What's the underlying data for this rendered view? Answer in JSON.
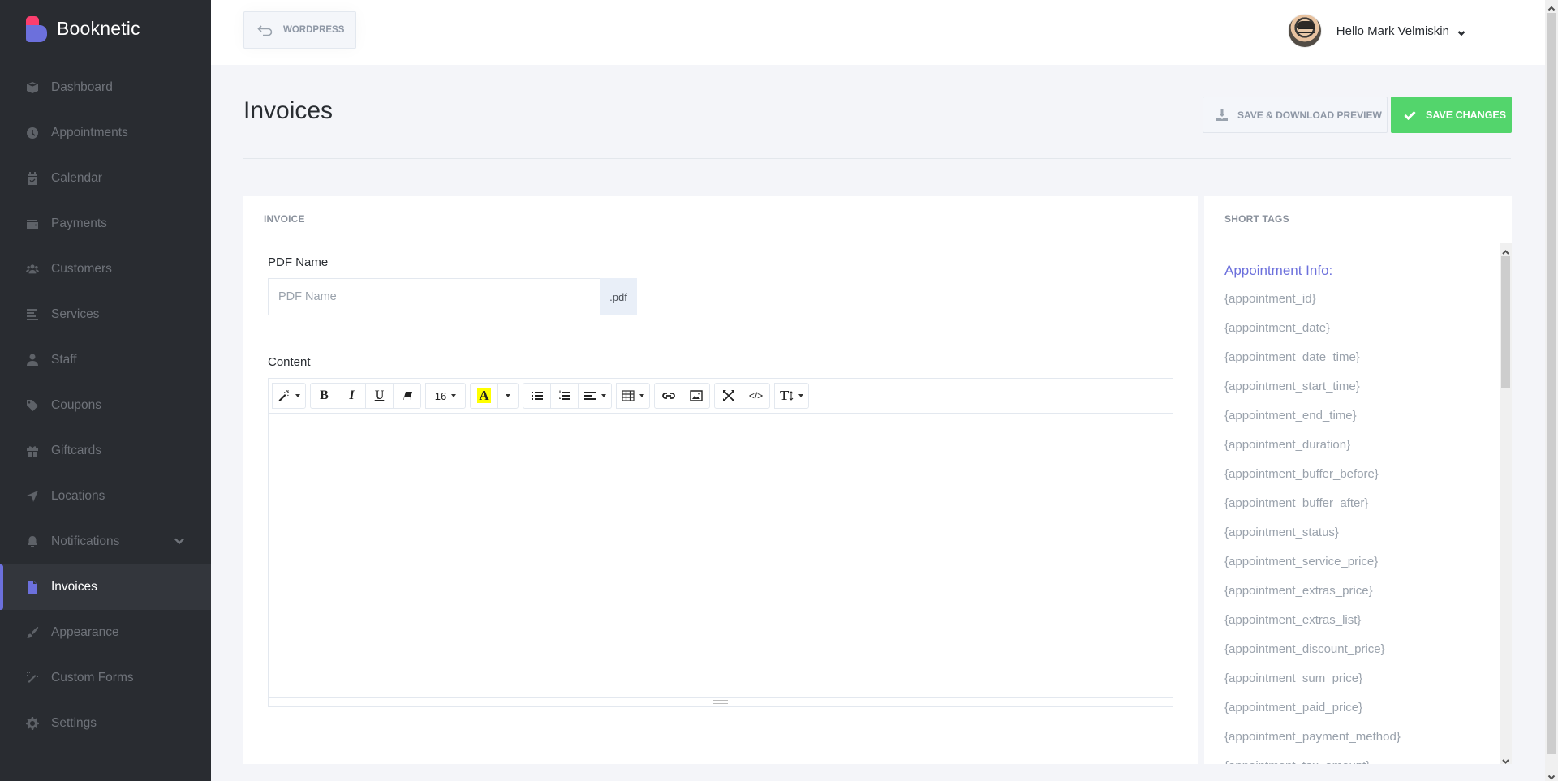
{
  "brand": {
    "name": "Booknetic",
    "colors": {
      "logo_top": "#fb3e6e",
      "logo_bottom": "#6c70dc",
      "accent": "#6c70dc",
      "success": "#53d56c"
    }
  },
  "sidebar": {
    "items": [
      {
        "label": "Dashboard",
        "icon": "box-icon"
      },
      {
        "label": "Appointments",
        "icon": "clock-icon"
      },
      {
        "label": "Calendar",
        "icon": "calendar-check-icon"
      },
      {
        "label": "Payments",
        "icon": "wallet-icon"
      },
      {
        "label": "Customers",
        "icon": "users-icon"
      },
      {
        "label": "Services",
        "icon": "align-left-icon"
      },
      {
        "label": "Staff",
        "icon": "user-icon"
      },
      {
        "label": "Coupons",
        "icon": "tag-icon"
      },
      {
        "label": "Giftcards",
        "icon": "gift-icon"
      },
      {
        "label": "Locations",
        "icon": "location-arrow-icon"
      },
      {
        "label": "Notifications",
        "icon": "bell-icon",
        "has_submenu": true
      },
      {
        "label": "Invoices",
        "icon": "file-icon",
        "active": true
      },
      {
        "label": "Appearance",
        "icon": "paint-brush-icon"
      },
      {
        "label": "Custom Forms",
        "icon": "magic-wand-icon"
      },
      {
        "label": "Settings",
        "icon": "gear-icon"
      }
    ]
  },
  "header": {
    "back_button": "WORDPRESS",
    "user_greeting": "Hello Mark Velmiskin"
  },
  "page": {
    "title": "Invoices",
    "preview_button": "SAVE & DOWNLOAD PREVIEW",
    "save_button": "SAVE CHANGES"
  },
  "invoice": {
    "section_title": "INVOICE",
    "pdf_name_label": "PDF Name",
    "pdf_name_value": "",
    "pdf_name_placeholder": "PDF Name",
    "pdf_suffix": ".pdf",
    "content_label": "Content",
    "toolbar": {
      "font_size": "16",
      "highlight_letter": "A",
      "typography_letter": "T"
    },
    "content_value": ""
  },
  "short_tags": {
    "section_title": "SHORT TAGS",
    "group_title": "Appointment Info:",
    "tags": [
      "{appointment_id}",
      "{appointment_date}",
      "{appointment_date_time}",
      "{appointment_start_time}",
      "{appointment_end_time}",
      "{appointment_duration}",
      "{appointment_buffer_before}",
      "{appointment_buffer_after}",
      "{appointment_status}",
      "{appointment_service_price}",
      "{appointment_extras_price}",
      "{appointment_extras_list}",
      "{appointment_discount_price}",
      "{appointment_sum_price}",
      "{appointment_paid_price}",
      "{appointment_payment_method}",
      "{appointment_tax_amount}"
    ]
  }
}
